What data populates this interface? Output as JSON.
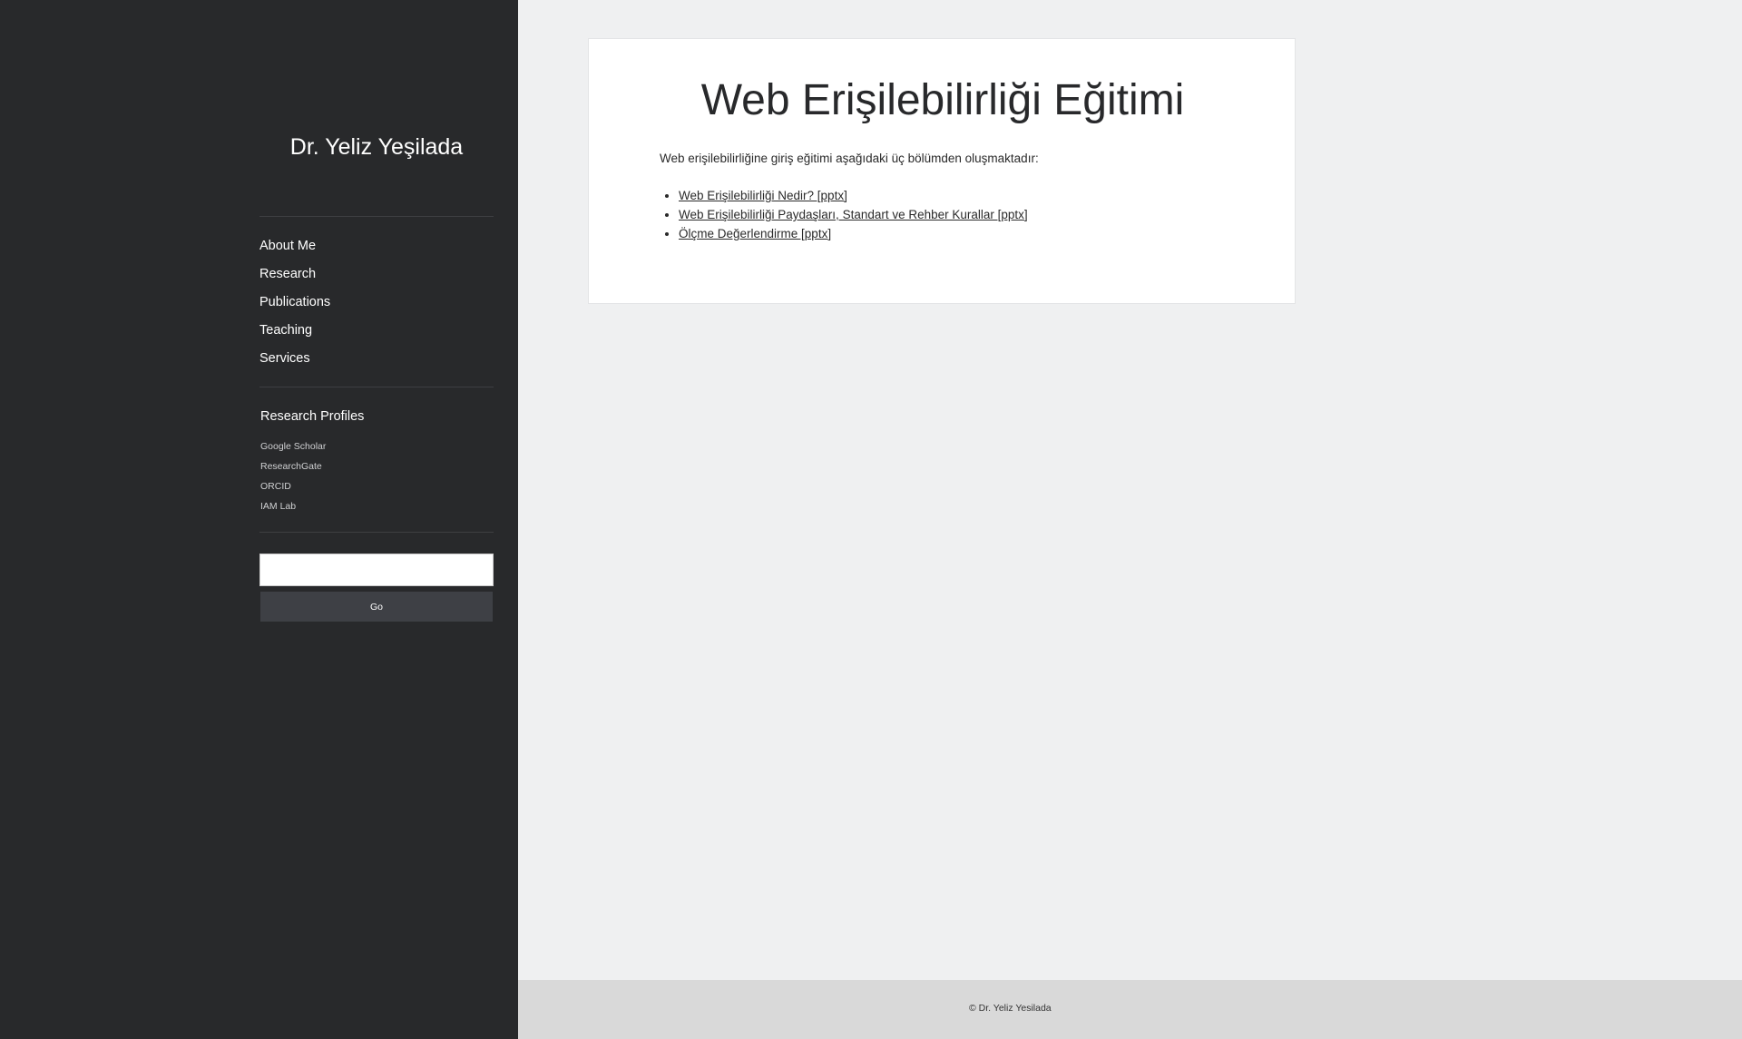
{
  "sidebar": {
    "site_title": "Dr. Yeliz Yeşilada",
    "nav": [
      {
        "label": "About Me"
      },
      {
        "label": "Research"
      },
      {
        "label": "Publications"
      },
      {
        "label": "Teaching"
      },
      {
        "label": "Services"
      }
    ],
    "profiles": {
      "title": "Research Profiles",
      "items": [
        {
          "label": "Google Scholar"
        },
        {
          "label": "ResearchGate"
        },
        {
          "label": "ORCID"
        },
        {
          "label": "IAM Lab"
        }
      ]
    },
    "search": {
      "value": "",
      "button_label": "Go"
    }
  },
  "main": {
    "title": "Web Erişilebilirliği Eğitimi",
    "intro": "Web erişilebilirliğine giriş eğitimi aşağıdaki üç bölümden oluşmaktadır:",
    "links": [
      {
        "label": "Web Erişilebilirliği Nedir? [pptx]"
      },
      {
        "label": "Web Erişilebilirliği Paydaşları, Standart ve Rehber Kurallar [pptx]"
      },
      {
        "label": "Ölçme Değerlendirme [pptx]"
      }
    ]
  },
  "footer": {
    "text": "© Dr. Yeliz Yesilada"
  },
  "colors": {
    "sidebar_bg": "#28292b",
    "page_bg": "#eff0f1",
    "footer_bg": "#d9d9d9",
    "button_bg": "#3e4045"
  }
}
